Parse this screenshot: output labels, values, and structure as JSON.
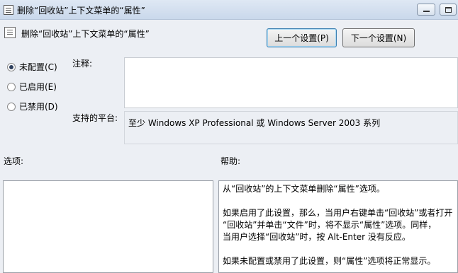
{
  "window": {
    "title": "删除“回收站”上下文菜单的“属性”"
  },
  "header": {
    "policy_title": "删除“回收站”上下文菜单的“属性”",
    "prev_button": "上一个设置(P)",
    "next_button": "下一个设置(N)"
  },
  "state": {
    "options": [
      {
        "label": "未配置(C)",
        "checked": true
      },
      {
        "label": "已启用(E)",
        "checked": false
      },
      {
        "label": "已禁用(D)",
        "checked": false
      }
    ]
  },
  "comment": {
    "label": "注释:",
    "value": ""
  },
  "platform": {
    "label": "支持的平台:",
    "value": "至少 Windows XP Professional 或 Windows Server 2003 系列"
  },
  "options_section": {
    "label": "选项:"
  },
  "help_section": {
    "label": "帮助:",
    "paragraph1": "从“回收站”的上下文菜单删除“属性”选项。",
    "paragraph2_line1": "如果启用了此设置，那么，当用户右键单击“回收站”或者打开",
    "paragraph2_line2": "“回收站”并单击“文件”时，将不显示“属性”选项。同样，",
    "paragraph2_line3": "当用户选择“回收站”时，按 Alt-Enter 没有反应。",
    "paragraph3": "如果未配置或禁用了此设置，则“属性”选项将正常显示。"
  }
}
